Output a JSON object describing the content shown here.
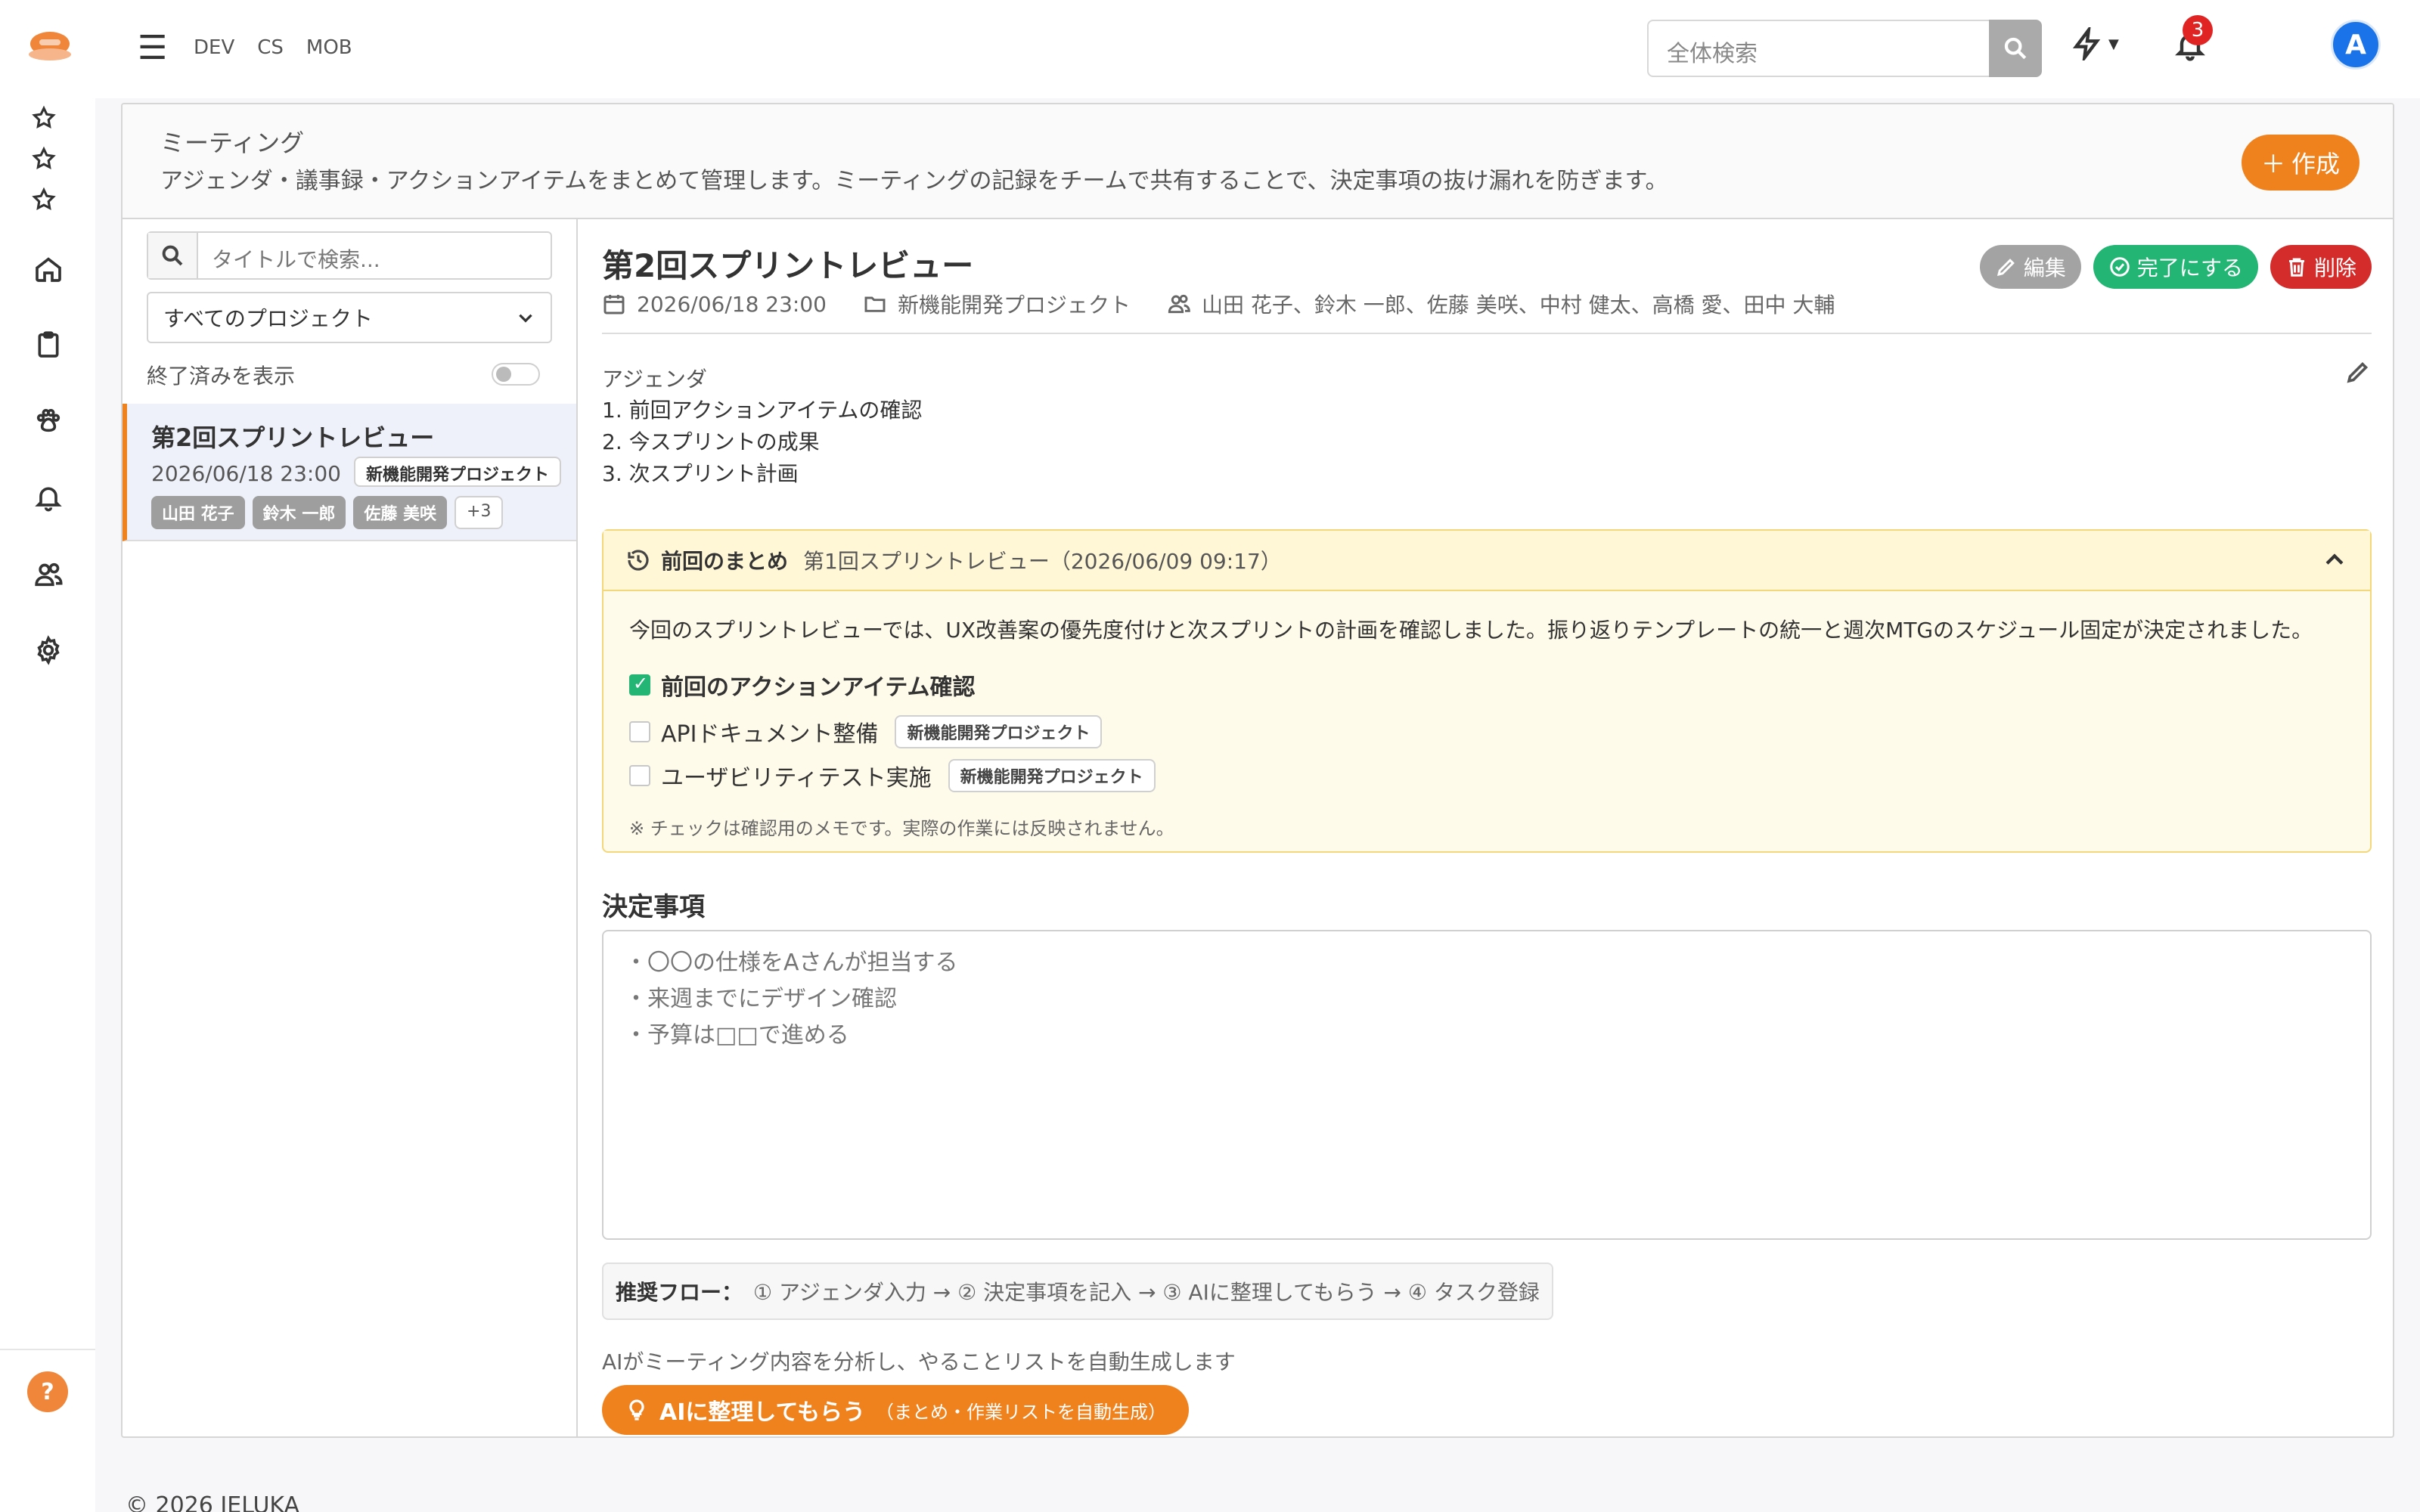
{
  "nav": {
    "env_links": [
      "DEV",
      "CS",
      "MOB"
    ],
    "search_placeholder": "全体検索",
    "notification_count": "3",
    "avatar_initial": "A",
    "help_label": "?"
  },
  "header": {
    "title": "ミーティング",
    "description": "アジェンダ・議事録・アクションアイテムをまとめて管理します。ミーティングの記録をチームで共有することで、決定事項の抜け漏れを防ぎます。",
    "create_label": "作成"
  },
  "list": {
    "search_placeholder": "タイトルで検索...",
    "project_filter": "すべてのプロジェクト",
    "show_done_label": "終了済みを表示",
    "items": [
      {
        "title": "第2回スプリントレビュー",
        "date": "2026/06/18 23:00",
        "project": "新機能開発プロジェクト",
        "participants": [
          "山田 花子",
          "鈴木 一郎",
          "佐藤 美咲"
        ],
        "more": "+3"
      }
    ]
  },
  "detail": {
    "title": "第2回スプリントレビュー",
    "date": "2026/06/18 23:00",
    "project": "新機能開発プロジェクト",
    "participants": "山田 花子、鈴木 一郎、佐藤 美咲、中村 健太、高橋 愛、田中 大輔",
    "actions": {
      "edit": "編集",
      "complete": "完了にする",
      "delete": "削除"
    },
    "agenda_label": "アジェンダ",
    "agenda_items": [
      "1. 前回アクションアイテムの確認",
      "2. 今スプリントの成果",
      "3. 次スプリント計画"
    ],
    "previous": {
      "label": "前回のまとめ",
      "reference": "第1回スプリントレビュー（2026/06/09 09:17）",
      "summary": "今回のスプリントレビューでは、UX改善案の優先度付けと次スプリントの計画を確認しました。振り返りテンプレートの統一と週次MTGのスケジュール固定が決定されました。",
      "checklist": [
        {
          "label": "前回のアクションアイテム確認",
          "checked": true,
          "project": ""
        },
        {
          "label": "APIドキュメント整備",
          "checked": false,
          "project": "新機能開発プロジェクト"
        },
        {
          "label": "ユーザビリティテスト実施",
          "checked": false,
          "project": "新機能開発プロジェクト"
        }
      ],
      "note": "※ チェックは確認用のメモです。実際の作業には反映されません。"
    },
    "decisions_label": "決定事項",
    "decisions_placeholder": [
      "・〇〇の仕様をAさんが担当する",
      "・来週までにデザイン確認",
      "・予算は□□で進める"
    ],
    "flow_label": "推奨フロー：",
    "flow_steps": "① アジェンダ入力 → ② 決定事項を記入 → ③ AIに整理してもらう → ④ タスク登録",
    "ai_note": "AIがミーティング内容を分析し、やることリストを自動生成します",
    "ai_button": "AIに整理してもらう",
    "ai_button_sub": "（まとめ・作業リストを自動生成）"
  },
  "footer": {
    "copyright": "© 2026 IELUKA"
  },
  "colors": {
    "accent": "#f0821e",
    "success": "#22b573",
    "danger": "#d42b2b",
    "brand_blue": "#1a73e8"
  }
}
